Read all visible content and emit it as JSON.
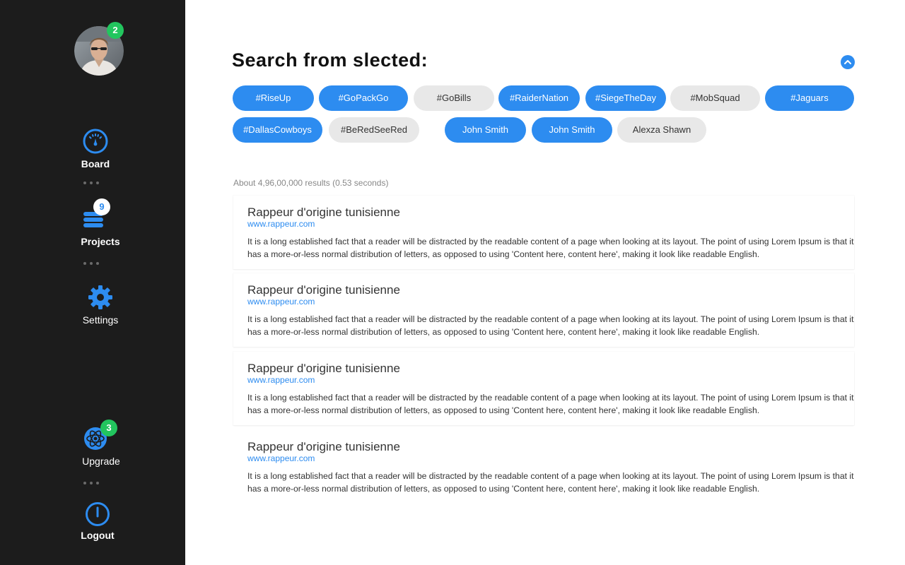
{
  "sidebar": {
    "avatar_badge": "2",
    "items": [
      {
        "label": "Board",
        "icon": "speedometer-icon"
      },
      {
        "label": "Projects",
        "icon": "stack-icon",
        "badge": "9"
      },
      {
        "label": "Settings",
        "icon": "gear-icon"
      },
      {
        "label": "Upgrade",
        "icon": "atom-icon",
        "badge": "3"
      },
      {
        "label": "Logout",
        "icon": "power-icon"
      }
    ]
  },
  "colors": {
    "accent": "#2d8cf0",
    "sidebar": "#1c1c1c",
    "badge_green": "#22c55e",
    "tag_off": "#e8e8e8"
  },
  "main": {
    "title": "Search from slected:",
    "tags": [
      {
        "label": "#RiseUp",
        "selected": true
      },
      {
        "label": "#GoPackGo",
        "selected": true
      },
      {
        "label": "#GoBills",
        "selected": false
      },
      {
        "label": "#RaiderNation",
        "selected": true
      },
      {
        "label": "#SiegeTheDay",
        "selected": true
      },
      {
        "label": "#MobSquad",
        "selected": false
      },
      {
        "label": "#Jaguars",
        "selected": true
      },
      {
        "label": "#DallasCowboys",
        "selected": true
      },
      {
        "label": "#BeRedSeeRed",
        "selected": false
      },
      {
        "label": "John Smith",
        "selected": true
      },
      {
        "label": "John Smith",
        "selected": true
      },
      {
        "label": "Alexza Shawn",
        "selected": false
      }
    ],
    "result_stats": "About 4,96,00,000 results (0.53 seconds)",
    "results": [
      {
        "title": "Rappeur d'origine tunisienne",
        "url": "www.rappeur.com",
        "desc": "It is a long established fact that a reader will be distracted by the readable content of a page when looking at its layout. The point of using Lorem Ipsum is that it has a more-or-less normal distribution of letters, as opposed to using 'Content here, content here', making it look like readable English."
      },
      {
        "title": "Rappeur d'origine tunisienne",
        "url": "www.rappeur.com",
        "desc": "It is a long established fact that a reader will be distracted by the readable content of a page when looking at its layout. The point of using Lorem Ipsum is that it has a more-or-less normal distribution of letters, as opposed to using 'Content here, content here', making it look like readable English."
      },
      {
        "title": "Rappeur d'origine tunisienne",
        "url": "www.rappeur.com",
        "desc": "It is a long established fact that a reader will be distracted by the readable content of a page when looking at its layout. The point of using Lorem Ipsum is that it has a more-or-less normal distribution of letters, as opposed to using 'Content here, content here', making it look like readable English."
      },
      {
        "title": "Rappeur d'origine tunisienne",
        "url": "www.rappeur.com",
        "desc": "It is a long established fact that a reader will be distracted by the readable content of a page when looking at its layout. The point of using Lorem Ipsum is that it has a more-or-less normal distribution of letters, as opposed to using 'Content here, content here', making it look like readable English."
      }
    ]
  }
}
